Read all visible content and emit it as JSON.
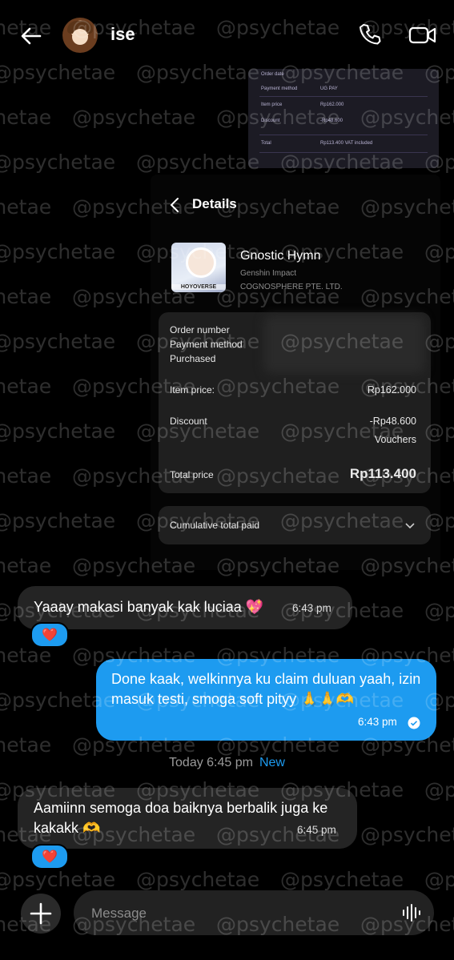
{
  "header": {
    "contact_name": "ise",
    "back_icon": "arrow-left-icon",
    "call_icon": "phone-icon",
    "video_icon": "video-camera-icon"
  },
  "image1": {
    "rows": [
      {
        "label": "Order date",
        "value": ""
      },
      {
        "label": "Payment method",
        "value": "UG PAY"
      },
      {
        "label": "Item price",
        "value": "Rp162.000"
      },
      {
        "label": "Discount",
        "value": "-Rp48.600"
      },
      {
        "label": "Total",
        "value": "Rp113.400 VAT included"
      }
    ]
  },
  "receipt": {
    "title": "Details",
    "product_name": "Gnostic Hymn",
    "product_game": "Genshin Impact",
    "product_company": "COGNOSPHERE PTE. LTD.",
    "icon_brand": "HOYOVERSE",
    "order_number_label": "Order number",
    "payment_method_label": "Payment method",
    "purchased_label": "Purchased",
    "item_price_label": "Item price:",
    "item_price_value": "Rp162.000",
    "discount_label": "Discount",
    "discount_value": "-Rp48.600",
    "discount_note": "Vouchers",
    "total_label": "Total price",
    "total_value": "Rp113.400",
    "cumulative_label": "Cumulative total paid"
  },
  "messages": [
    {
      "direction": "in",
      "text": "Yaaay makasi banyak kak luciaa 💖",
      "time": "6:43 pm",
      "reaction": "❤️"
    },
    {
      "direction": "out",
      "text": "Done kaak, welkinnya ku claim duluan yaah, izin masuk testi, smoga soft pityy 🙏🙏🫶",
      "time": "6:43 pm"
    },
    {
      "direction": "in",
      "text": "Aamiinn semoga doa baiknya berbalik juga ke kakakk 🫶",
      "time": "6:45 pm",
      "reaction": "❤️"
    }
  ],
  "date_separator": {
    "text": "Today 6:45 pm",
    "new_label": "New"
  },
  "composer": {
    "placeholder": "Message"
  },
  "watermark": "@psychetae",
  "colors": {
    "accent": "#1d9bf0",
    "background": "#000000",
    "bubble_in": "#242424"
  }
}
